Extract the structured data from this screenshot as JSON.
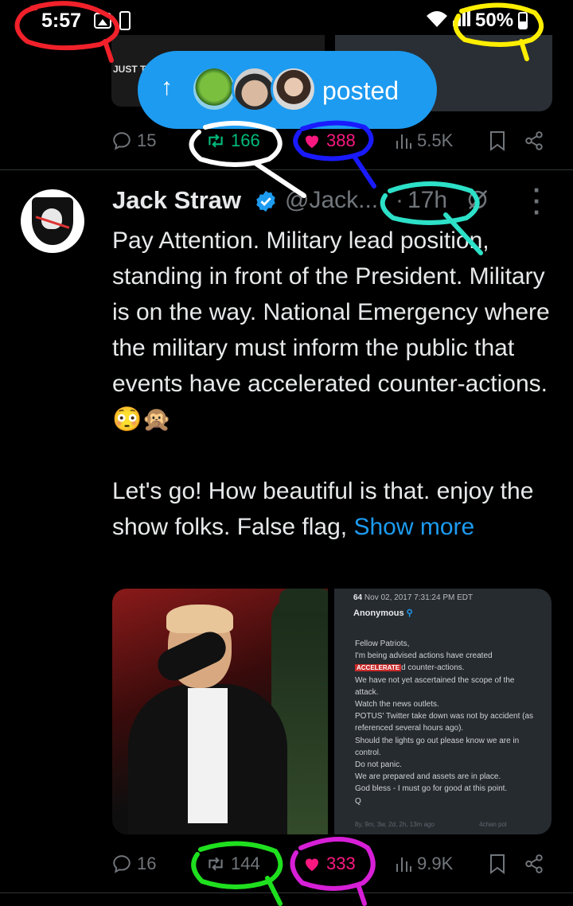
{
  "status_bar": {
    "time": "5:57",
    "battery": "50%"
  },
  "prev_tweet": {
    "media_label": "JUST T",
    "actions": {
      "replies": "15",
      "reposts": "166",
      "likes": "388",
      "views": "5.5K"
    }
  },
  "posted_pill": {
    "label": "posted"
  },
  "tweet": {
    "name": "Jack Straw",
    "handle": "@Jack...",
    "separator": "·",
    "time": "17h",
    "body_text": "Pay Attention. Military lead position, standing in front of the President. Military is on the way. National Emergency where the military must inform the public that events have accelerated counter-actions. 😳🙊\n\nLet's go! How beautiful is that. enjoy the show folks. False flag, ",
    "show_more": "Show more",
    "media_quote": {
      "post_number": "64",
      "post_date": "Nov 02, 2017 7:31:24 PM EDT",
      "author": "Anonymous",
      "highlight": "ACCELERATE",
      "line1": "Fellow Patriots,\nI'm being advised actions have created\n",
      "line2": "d counter-actions.\nWe have not yet ascertained the scope of the attack.\nWatch the news outlets.\nPOTUS' Twitter take down was not by accident (as referenced several hours ago).\nShould the lights go out please know we are in control.\nDo not panic.\nWe are prepared and assets are in place.\nGod bless - I must go for good at this point.\nQ",
      "footer_left": "8y, 9m, 3w, 2d, 2h, 13m ago",
      "footer_right": "4chan pol"
    },
    "actions": {
      "replies": "16",
      "reposts": "144",
      "likes": "333",
      "views": "9.9K"
    }
  },
  "annotation_colors": {
    "red": "#f0212a",
    "yellow": "#ffee00",
    "white": "#ffffff",
    "blue": "#1a1aff",
    "cyan": "#2de0c8",
    "green": "#1fe01f",
    "magenta": "#d61fd6"
  }
}
